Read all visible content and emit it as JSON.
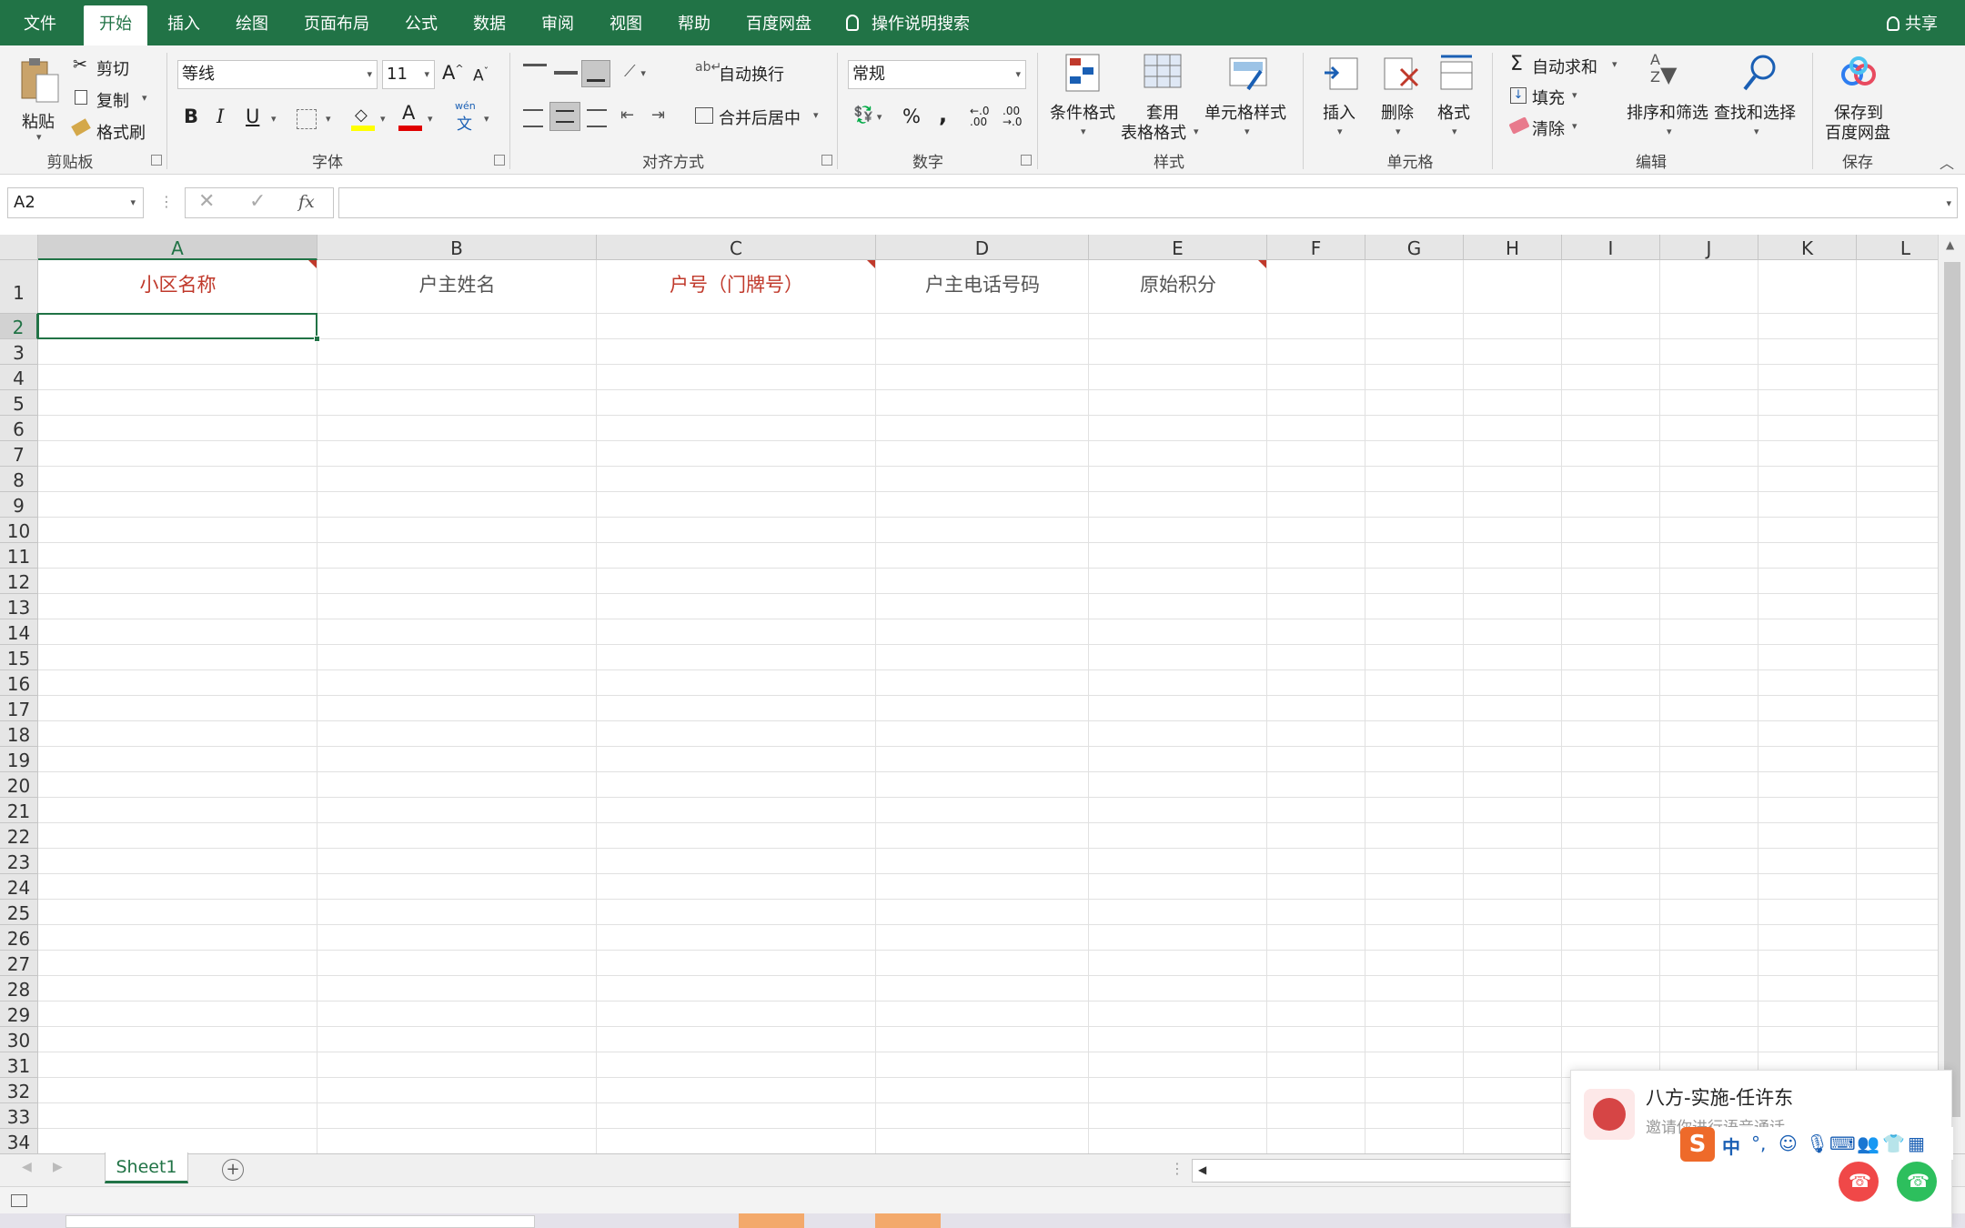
{
  "menu": {
    "tabs": [
      "文件",
      "开始",
      "插入",
      "绘图",
      "页面布局",
      "公式",
      "数据",
      "审阅",
      "视图",
      "帮助",
      "百度网盘"
    ],
    "active_tab": "开始",
    "search": "操作说明搜索",
    "share": "共享"
  },
  "ribbon": {
    "clipboard": {
      "paste": "粘贴",
      "cut": "剪切",
      "copy": "复制",
      "format_painter": "格式刷",
      "label": "剪贴板"
    },
    "font": {
      "font_name": "等线",
      "font_size": "11",
      "bold": "B",
      "italic": "I",
      "underline": "U",
      "phonetic_top": "wén",
      "phonetic_bottom": "文",
      "label": "字体"
    },
    "alignment": {
      "wrap_text": "自动换行",
      "merge_center": "合并后居中",
      "label": "对齐方式"
    },
    "number": {
      "format": "常规",
      "percent": "%",
      "comma": ",",
      "label": "数字"
    },
    "styles": {
      "conditional": "条件格式",
      "table_format_1": "套用",
      "table_format_2": "表格格式",
      "cell_styles": "单元格样式",
      "label": "样式"
    },
    "cells": {
      "insert": "插入",
      "delete": "删除",
      "format": "格式",
      "label": "单元格"
    },
    "editing": {
      "autosum": "自动求和",
      "fill": "填充",
      "clear": "清除",
      "sort_filter": "排序和筛选",
      "find_select": "查找和选择",
      "label": "编辑"
    },
    "save": {
      "save_1": "保存到",
      "save_2": "百度网盘",
      "label": "保存"
    }
  },
  "formula_bar": {
    "name_box": "A2",
    "fx": "fx",
    "value": ""
  },
  "sheet": {
    "columns": [
      "A",
      "B",
      "C",
      "D",
      "E",
      "F",
      "G",
      "H",
      "I",
      "J",
      "K",
      "L"
    ],
    "selected_column": "A",
    "rows": [
      "1",
      "2",
      "3",
      "4",
      "5",
      "6",
      "7",
      "8",
      "9",
      "10",
      "11",
      "12",
      "13",
      "14",
      "15",
      "16",
      "17",
      "18",
      "19",
      "20",
      "21",
      "22",
      "23",
      "24",
      "25",
      "26",
      "27",
      "28",
      "29",
      "30",
      "31",
      "32",
      "33",
      "34"
    ],
    "selected_row": "2",
    "header_row": [
      {
        "col": "A",
        "text": "小区名称",
        "color": "#c0392b",
        "comment": true
      },
      {
        "col": "B",
        "text": "户主姓名",
        "color": "#555555",
        "comment": false
      },
      {
        "col": "C",
        "text": "户号（门牌号）",
        "color": "#c0392b",
        "comment": true
      },
      {
        "col": "D",
        "text": "户主电话号码",
        "color": "#555555",
        "comment": false
      },
      {
        "col": "E",
        "text": "原始积分",
        "color": "#555555",
        "comment": true
      }
    ],
    "tab": "Sheet1"
  },
  "notification": {
    "title": "八方-实施-任许东",
    "subtitle": "邀请你进行语音通话"
  },
  "ime": {
    "lang": "中",
    "punct": "°,"
  },
  "colors": {
    "brand": "#217346",
    "accent_red": "#c0392b"
  }
}
